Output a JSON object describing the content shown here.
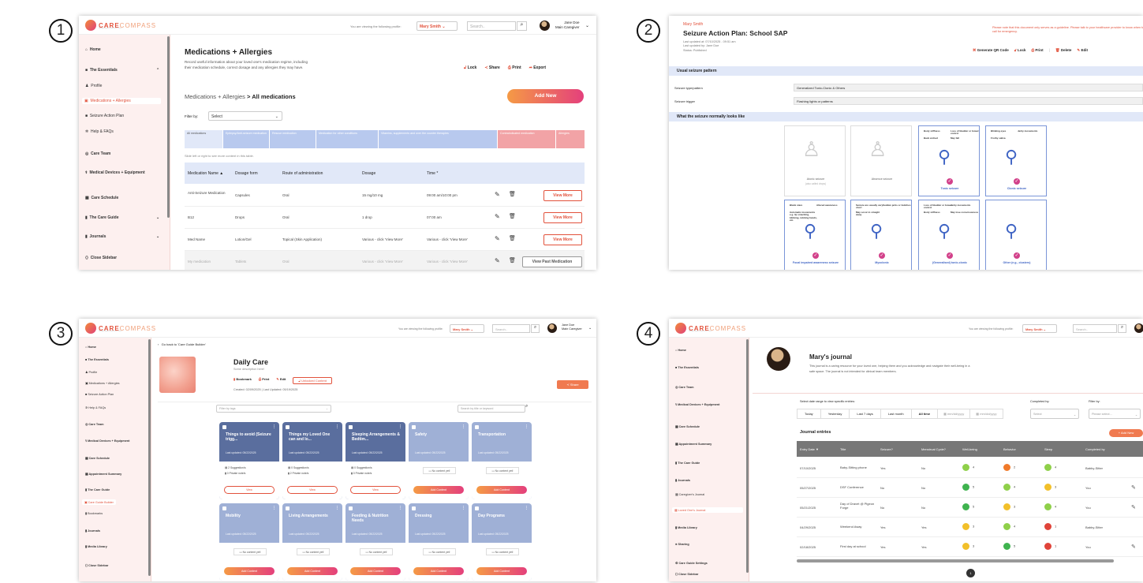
{
  "numbers": [
    "1",
    "2",
    "3",
    "4"
  ],
  "brand": {
    "name": "CARE",
    "name2": "COMPASS",
    "tagline": "Navigating your loved one's care"
  },
  "topbar": {
    "viewing": "You are viewing the following profile:",
    "profile": "Mary Smith",
    "search": "Search..",
    "user": "Jane Doe",
    "role": "Main Caregiver"
  },
  "p1": {
    "side": [
      "Home",
      "The Essentials",
      "Profile",
      "Medications + Allergies",
      "Seizure Action Plan",
      "Help & FAQs",
      "Care Team",
      "Medical Devices + Equipment",
      "Care Schedule",
      "The Care Guide",
      "Journals",
      "Close Sidebar"
    ],
    "title": "Medications + Allergies",
    "desc1": "Record useful information about your loved one's medication regime, including",
    "desc2": "their medication schedule, correct dosage and any allergies they may have.",
    "actions": [
      "Lock",
      "Share",
      "Print",
      "Export"
    ],
    "crumb1": "Medications + Allergies",
    "crumb2": "> All medications",
    "add": "Add New",
    "filter": "Filter by:",
    "select": "Select",
    "tabs": [
      "All medications",
      "Epilepsy/Anti-seizure medication",
      "Rescue medication",
      "Medication for other conditions",
      "Vitamins, supplements and over the counter therapies",
      "Contraindicated medication",
      "Allergies"
    ],
    "hint": "Slide left or right to see more content in this table.",
    "cols": [
      "Medication Name ▲",
      "Dosage form",
      "Route of administration",
      "Dosage",
      "Time *"
    ],
    "rows": [
      [
        "Anti-Seizure Medication",
        "Capsules",
        "Oral",
        "15 mg/10 mg",
        "09:00 am/10:00 pm",
        "View More"
      ],
      [
        "B12",
        "Drops",
        "Oral",
        "1 drop",
        "07:00 am",
        "View More"
      ],
      [
        "Med Name",
        "Lotion/Gel",
        "Topical (Skin Application)",
        "Various - click 'View More'",
        "Various - click 'View More'",
        "View More"
      ],
      [
        "My medication",
        "Tablets",
        "Oral",
        "Various - click 'View More'",
        "Various - click 'View More'",
        "View Past Medication"
      ]
    ]
  },
  "p2": {
    "name": "Mary Smith",
    "title": "Seizure Action Plan: School SAP",
    "meta": [
      "Last updated at: 07/10/2025 - 09:51 am",
      "Last updated by: Jane Doe",
      "Status: Published"
    ],
    "note": "Please note that this document only serves as a guideline. Please talk to your healthcare provider to know when to call for emergency.",
    "actions": [
      "Generate QR Code",
      "Lock",
      "Print",
      "Delete",
      "Edit"
    ],
    "sec1": "Usual seizure pattern",
    "f1": "Seizure type/pattern",
    "v1": "Generalized Tonic-Clonic & Others",
    "f2": "Seizure trigger",
    "v2": "Flashing lights or patterns",
    "sec2": "What the seizure normally looks like",
    "cards": [
      {
        "label": "Atonic seizure",
        "sub": "(also called drops)"
      },
      {
        "label": "Absence seizure",
        "sub": ""
      },
      {
        "label": "Tonic seizure",
        "notes": [
          "Body stiffness",
          "Loss of bladder or bowel control",
          "Back arched",
          "May fall"
        ]
      },
      {
        "label": "Clonic seizure",
        "notes": [
          "Blinking eyes",
          "Jerky movements",
          "Frothy saliva"
        ]
      },
      {
        "label": "Focal impaired awareness seizure",
        "notes": [
          "Blank stare",
          "Altered awareness",
          "Automatic movements e.g. lip smacking, blinking, rubbing hands, etc."
        ]
      },
      {
        "label": "Myoclonic",
        "notes": [
          "Seizure are usually very short",
          "Sudden jerks or twitches",
          "May occur in straight away"
        ]
      },
      {
        "label": "(Generalised) tonic-clonic",
        "notes": [
          "Loss of bladder or bowel control",
          "Jerky movements",
          "Body stiffness",
          "May lose consciousness"
        ]
      },
      {
        "label": "Other (e.g., clusters)",
        "notes": []
      }
    ]
  },
  "p3": {
    "side": [
      "Home",
      "The Essentials",
      "Profile",
      "Medications + Allergies",
      "Seizure Action Plan",
      "Help & FAQs",
      "Care Team",
      "Medical Devices + Equipment",
      "Care Schedule",
      "Appointment Summary",
      "The Care Guide",
      "Care Guide Builder",
      "Bookmarks",
      "Journals",
      "Media Library",
      "Close Sidebar"
    ],
    "back": "Go back to 'Care Guide Builder'",
    "title": "Daily Care",
    "desc": "Some description here!",
    "actions": [
      "Bookmark",
      "Print",
      "Edit",
      "Unlocked Content"
    ],
    "meta": "Created: 02/09/2025 | Last Updated: 05/19/2025",
    "share": "Share",
    "filter": "Filter by tags",
    "search": "Search by title or keyword",
    "cards": [
      {
        "t": "Things to avoid (Seizure trigg...",
        "u": "Last updated: 05/22/2025",
        "s": "2 Suggestion/s",
        "p": "0 Private note/s",
        "b": "View"
      },
      {
        "t": "Things my Loved One can and lo...",
        "u": "Last updated: 05/22/2025",
        "s": "0 Suggestion/s",
        "p": "2 Private note/s",
        "b": "View"
      },
      {
        "t": "Sleeping Arrangements & Bedtim...",
        "u": "Last updated: 05/22/2025",
        "s": "0 Suggestion/s",
        "p": "0 Private note/s",
        "b": "View"
      },
      {
        "t": "Safety",
        "u": "Last updated: 05/22/2025",
        "e": "No content yet!",
        "b": "Add Content"
      },
      {
        "t": "Transportation",
        "u": "Last updated: 05/22/2025",
        "e": "No content yet!",
        "b": "Add Content"
      },
      {
        "t": "Mobility",
        "u": "Last updated: 05/22/2025",
        "e": "No content yet!",
        "b": "Add Content"
      },
      {
        "t": "Living Arrangements",
        "u": "Last updated: 05/22/2025",
        "e": "No content yet!",
        "b": "Add Content"
      },
      {
        "t": "Feeding & Nutrition Needs",
        "u": "Last updated: 05/22/2025",
        "e": "No content yet!",
        "b": "Add Content"
      },
      {
        "t": "Dressing",
        "u": "Last updated: 05/22/2025",
        "e": "No content yet!",
        "b": "Add Content"
      },
      {
        "t": "Day Programs",
        "u": "Last updated: 05/22/2025",
        "e": "No content yet!",
        "b": "Add Content"
      }
    ]
  },
  "p4": {
    "side": [
      "Home",
      "The Essentials",
      "Care Team",
      "Medical Devices + Equipment",
      "Care Schedule",
      "Appointment Summary",
      "The Care Guide",
      "Journals",
      "Caregiver's Journal",
      "Loved One's Journal",
      "Media Library",
      "Sharing",
      "Care Guide Settings",
      "Close Sidebar"
    ],
    "title": "Mary's journal",
    "desc1": "This journal is a caring resource for your loved one, helping them and you acknowledge and navigate their well-being in a",
    "desc2": "safe space. The journal is not intended for clinical team members.",
    "range": "Select date range to view specific entries:",
    "dates": [
      "Today",
      "Yesterday",
      "Last 7 days",
      "Last month",
      "All time"
    ],
    "date_ph": "mm/dd/yyyy",
    "completed": "Completed by:",
    "filterby": "Filter by:",
    "select": "Select",
    "please": "Please select...",
    "entries": "Journal entries",
    "add": "+ Add New",
    "cols": [
      "Entry Date ▼",
      "Title",
      "Seizure?",
      "Menstrual Cycle?",
      "Well-being",
      "Behavior",
      "Sleep",
      "Completed by"
    ],
    "rows": [
      [
        "07/10/2025",
        "Baby-Sitting phone",
        "Yes",
        "No",
        "4",
        "2",
        "4",
        "Babby-Sitter"
      ],
      [
        "05/27/2025",
        "DSF Conference",
        "No",
        "No",
        "5",
        "4",
        "3",
        "You"
      ],
      [
        "05/21/2025",
        "Day of Dravet @ Pigeon Forge",
        "No",
        "No",
        "5",
        "3",
        "4",
        "You"
      ],
      [
        "04/29/2025",
        "Weekend Away",
        "Yes",
        "Yes",
        "3",
        "4",
        "1",
        "Babby-Sitter"
      ],
      [
        "02/18/2025",
        "First day at school",
        "Yes",
        "Yes",
        "3",
        "5",
        "1",
        "You"
      ]
    ],
    "page": "1"
  },
  "colors": {
    "accent": "#e2523c",
    "pink": "#d2418a",
    "blue_tab": "#b8c9ee",
    "red_tab": "#f2a3a6",
    "card_dark": "#5a6e9e",
    "card_light": "#9fb0d6"
  }
}
